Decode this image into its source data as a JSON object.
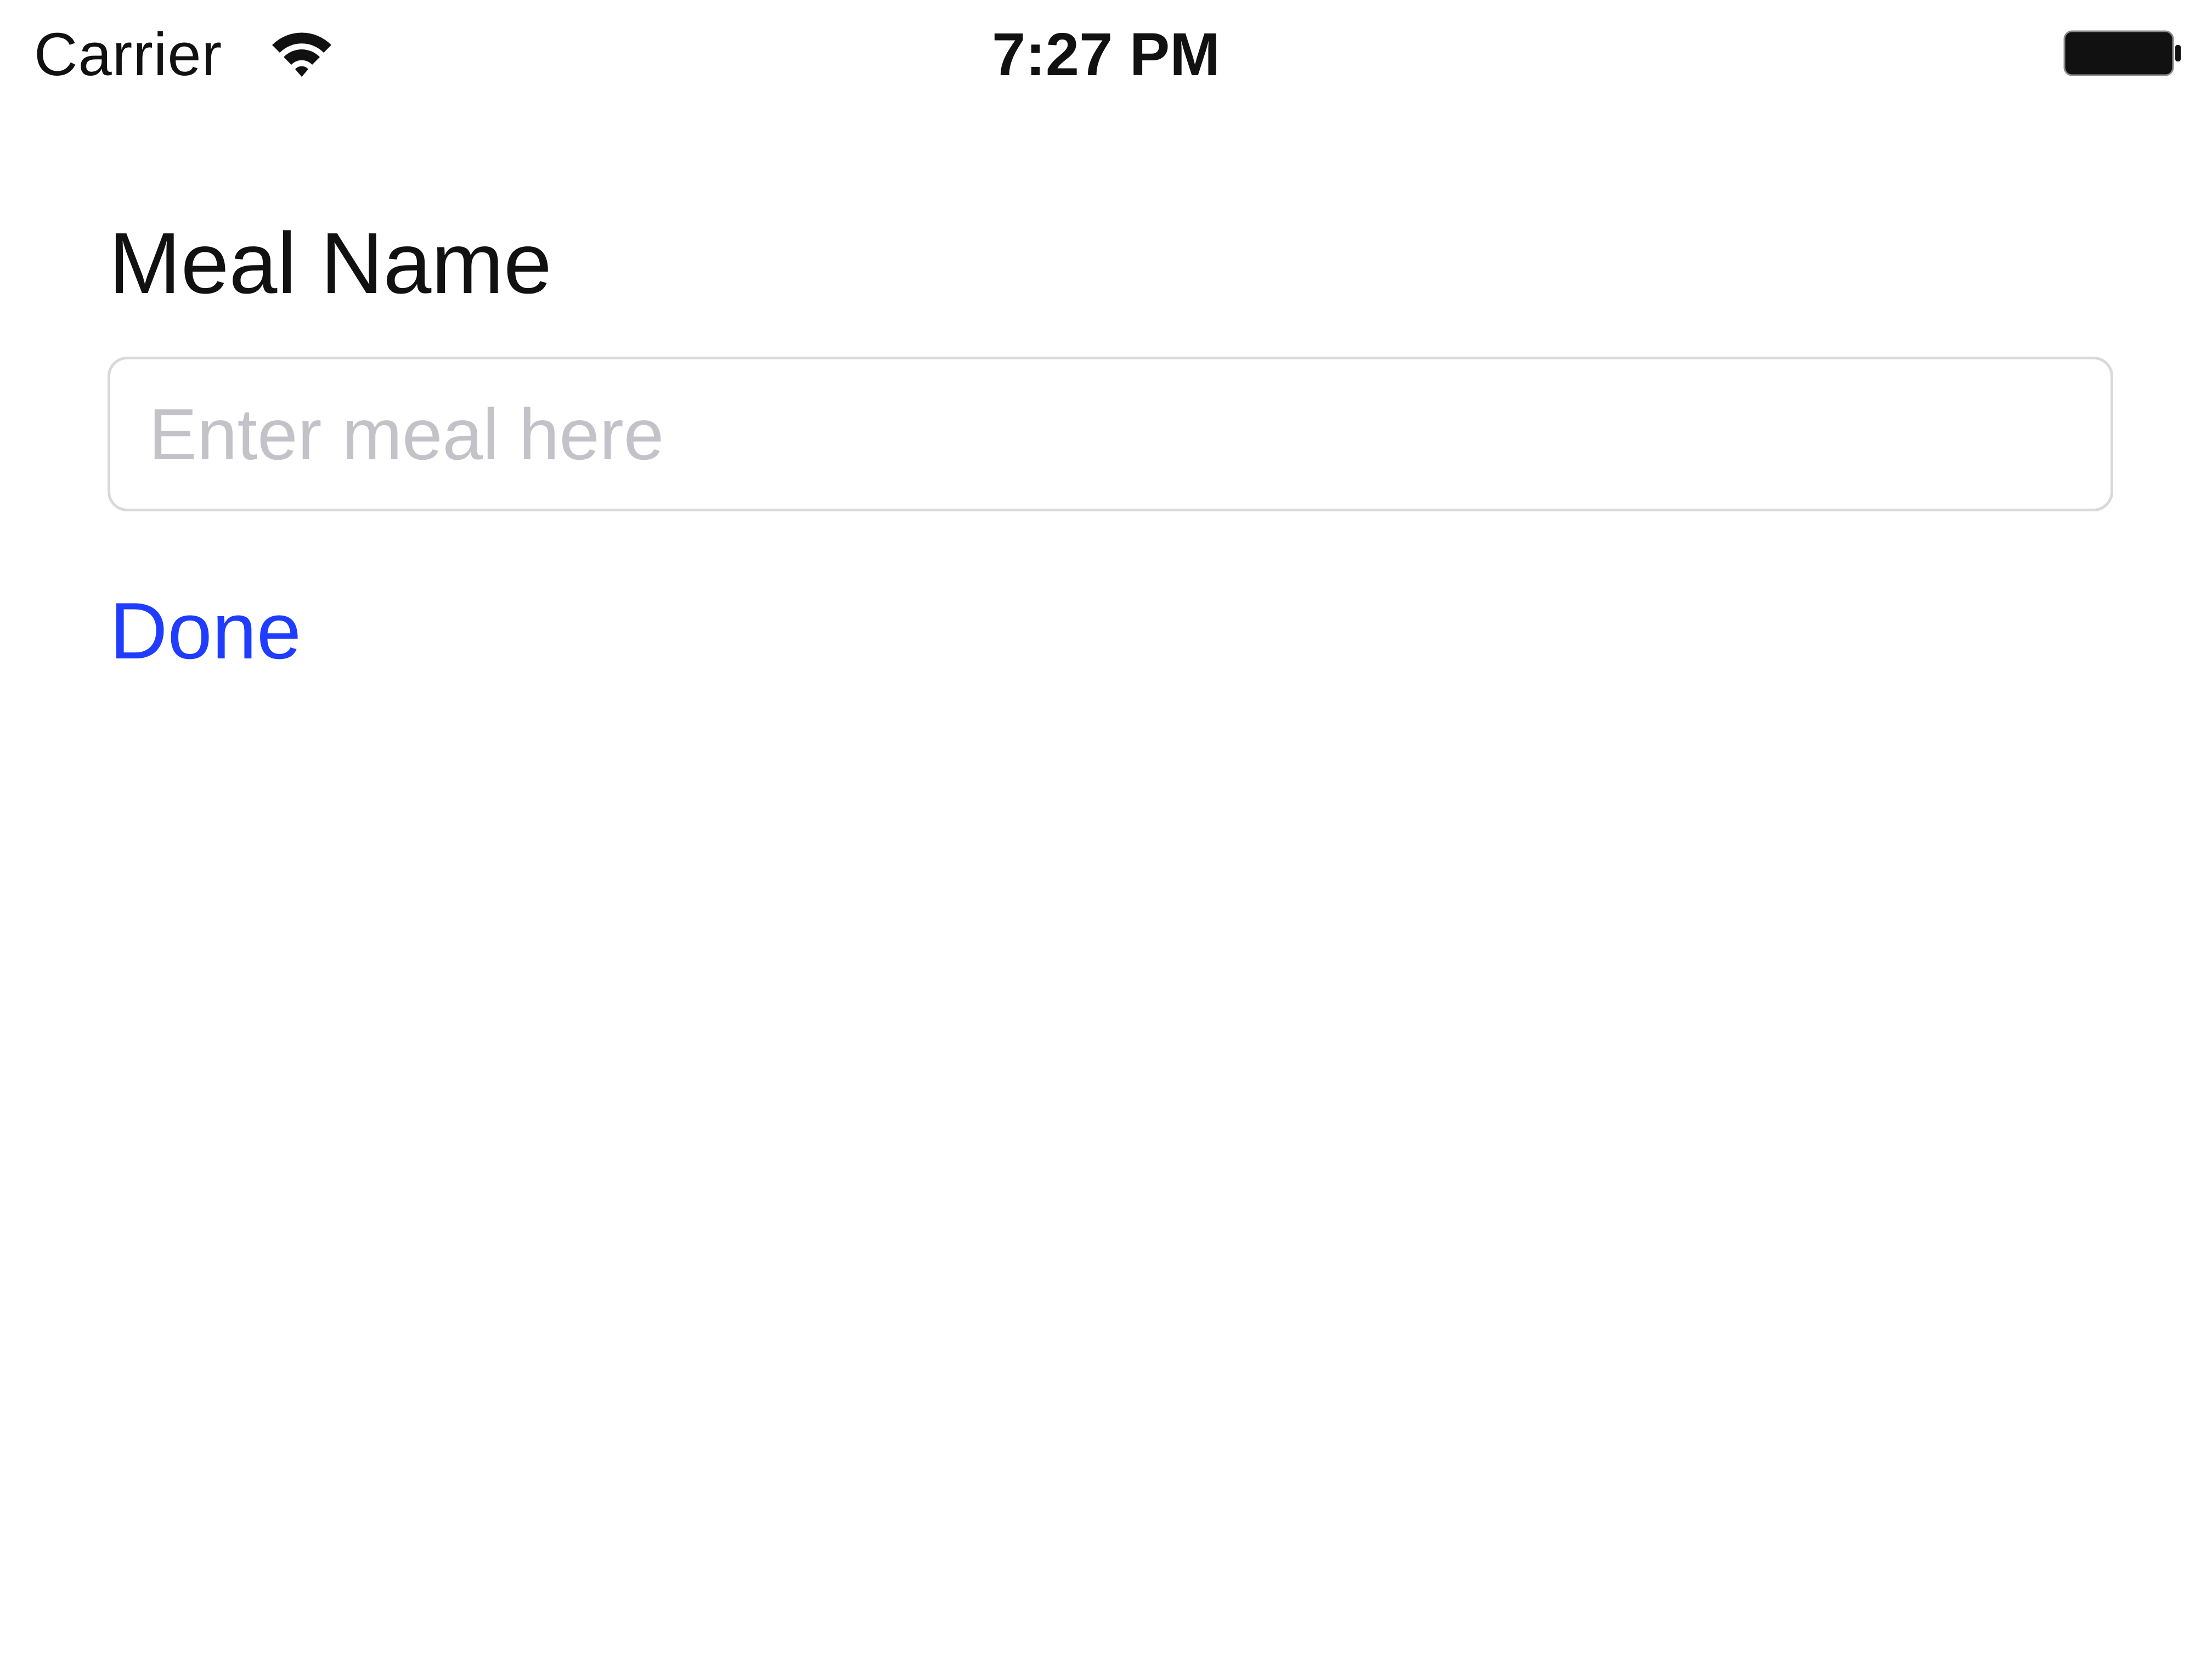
{
  "status_bar": {
    "carrier": "Carrier",
    "time": "7:27 PM",
    "wifi_icon": "wifi-icon",
    "battery_icon": "battery-full-icon",
    "battery_level": 1.0
  },
  "form": {
    "label": "Meal Name",
    "input": {
      "value": "",
      "placeholder": "Enter meal here"
    },
    "done_label": "Done"
  },
  "colors": {
    "background": "#ffffff",
    "text": "#111111",
    "placeholder": "#c2c2c8",
    "accent": "#1f3cff",
    "input_border": "#d9d9d9"
  }
}
